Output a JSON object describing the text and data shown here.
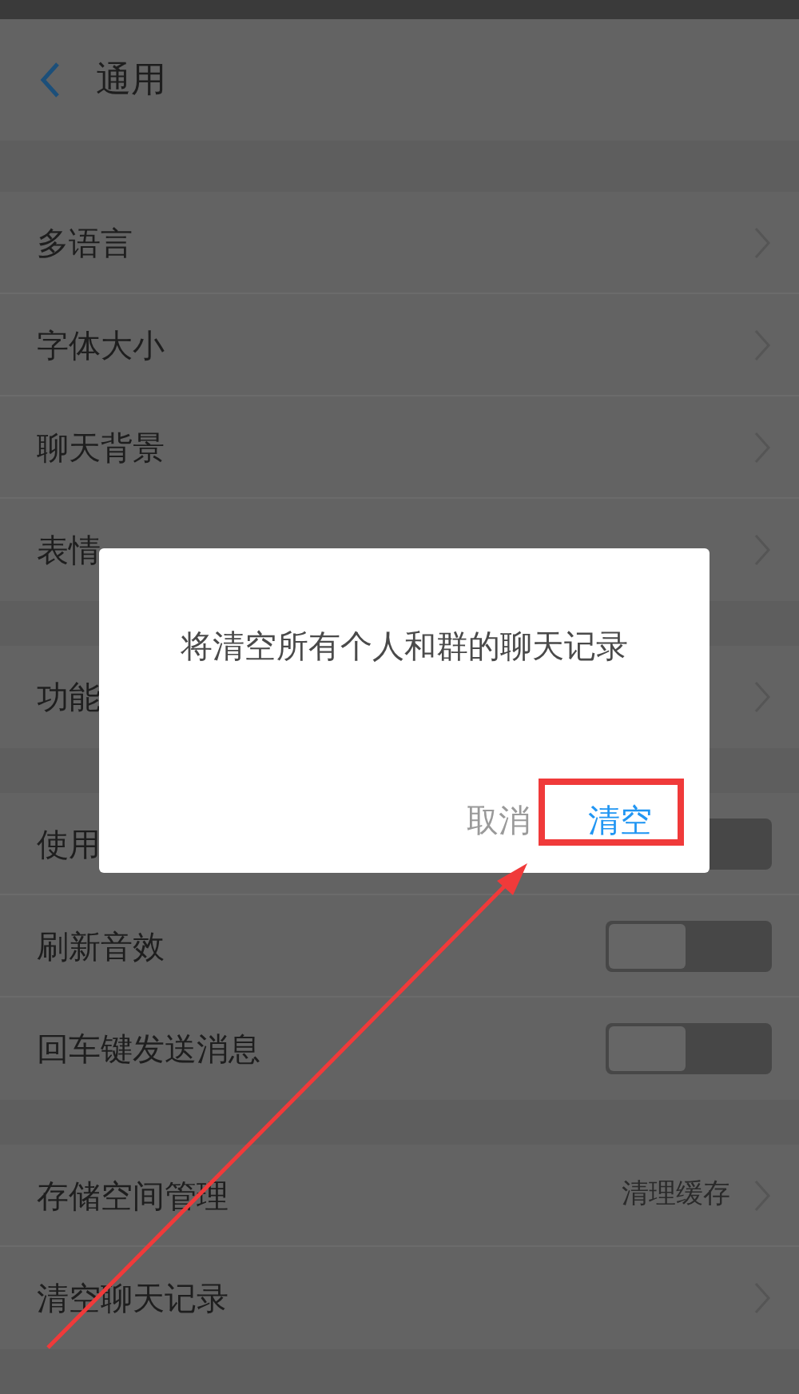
{
  "header": {
    "title": "通用"
  },
  "groups": [
    {
      "items": [
        {
          "kind": "link",
          "label": "多语言"
        },
        {
          "kind": "link",
          "label": "字体大小"
        },
        {
          "kind": "link",
          "label": "聊天背景"
        },
        {
          "kind": "link",
          "label": "表情"
        }
      ]
    },
    {
      "items": [
        {
          "kind": "link",
          "label": "功能"
        }
      ]
    },
    {
      "items": [
        {
          "kind": "toggle",
          "label": "使用",
          "on": false
        },
        {
          "kind": "toggle",
          "label": "刷新音效",
          "on": false
        },
        {
          "kind": "toggle",
          "label": "回车键发送消息",
          "on": false
        }
      ]
    },
    {
      "items": [
        {
          "kind": "link",
          "label": "存储空间管理",
          "value": "清理缓存"
        },
        {
          "kind": "link",
          "label": "清空聊天记录"
        }
      ]
    }
  ],
  "dialog": {
    "message": "将清空所有个人和群的聊天记录",
    "buttons": [
      {
        "kind": "cancel",
        "label": "取消"
      },
      {
        "kind": "confirm",
        "label": "清空"
      }
    ]
  }
}
